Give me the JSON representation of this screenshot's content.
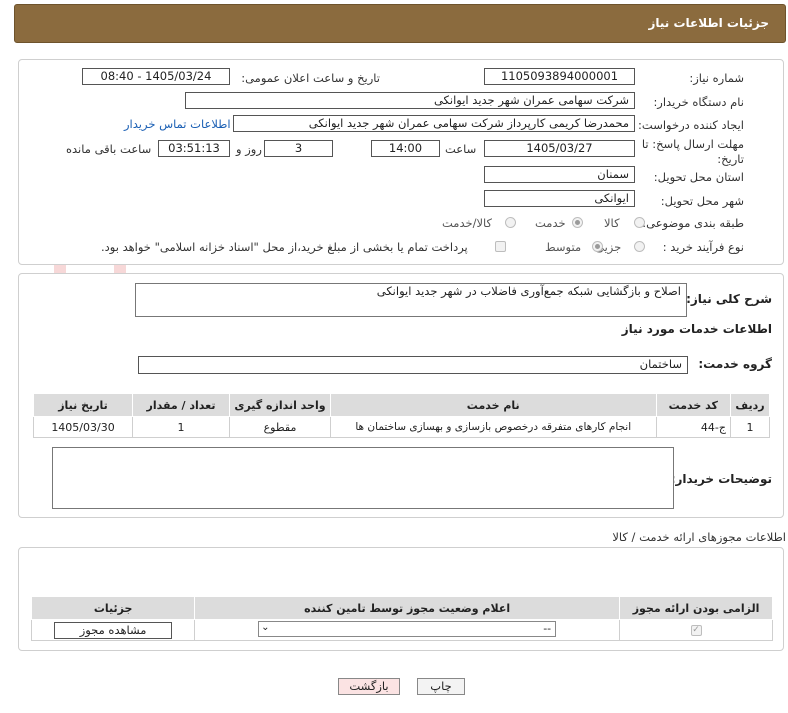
{
  "header": {
    "title": "جزئیات اطلاعات نیاز"
  },
  "form": {
    "need_number_label": "شماره نیاز:",
    "need_number": "1105093894000001",
    "announce_label": "تاریخ و ساعت اعلان عمومی:",
    "announce_value": "1405/03/24 - 08:40",
    "buyer_org_label": "نام دستگاه خریدار:",
    "buyer_org": "شرکت سهامی عمران شهر جدید ایوانکی",
    "creator_label": "ایجاد کننده درخواست:",
    "creator": "محمدرضا کریمی کارپرداز شرکت سهامی عمران شهر جدید ایوانکی",
    "contact_link": "اطلاعات تماس خریدار",
    "deadline_label_1": "مهلت ارسال پاسخ: تا",
    "deadline_label_2": "تاریخ:",
    "deadline_date": "1405/03/27",
    "time_label": "ساعت",
    "deadline_time": "14:00",
    "days_value": "3",
    "days_label": "روز و",
    "remaining_time": "03:51:13",
    "remaining_label": "ساعت باقی مانده",
    "province_label": "استان محل تحویل:",
    "province": "سمنان",
    "city_label": "شهر محل تحویل:",
    "city": "ایوانکی",
    "category_label": "طبقه بندی موضوعی:",
    "category_options": [
      "کالا",
      "خدمت",
      "کالا/خدمت"
    ],
    "category_selected": "خدمت",
    "process_label": "نوع فرآیند خرید :",
    "process_options": [
      "جزیی",
      "متوسط"
    ],
    "process_selected": "متوسط",
    "payment_note": "پرداخت تمام یا بخشی از مبلغ خرید،از محل \"اسناد خزانه اسلامی\" خواهد بود."
  },
  "summary": {
    "label": "شرح کلی نیاز:",
    "value": "اصلاح و بازگشایی شبکه جمع‌آوری فاضلاب در شهر جدید ایوانکی"
  },
  "services": {
    "section_title": "اطلاعات خدمات مورد نیاز",
    "group_label": "گروه خدمت:",
    "group_value": "ساختمان",
    "columns": [
      "ردیف",
      "کد خدمت",
      "نام خدمت",
      "واحد اندازه گیری",
      "تعداد / مقدار",
      "تاریخ نیاز"
    ],
    "rows": [
      [
        "1",
        "ج-44",
        "انجام کارهای متفرقه درخصوص بازسازی و بهسازی ساختمان ها",
        "مقطوع",
        "1",
        "1405/03/30"
      ]
    ],
    "buyer_notes_label": "توضیحات خریدار:"
  },
  "permits": {
    "section_title": "اطلاعات مجوزهای ارائه خدمت / کالا",
    "columns": [
      "الزامی بودن ارائه مجوز",
      "اعلام وضعیت مجوز توسط تامین کننده",
      "جزئیات"
    ],
    "select_value": "--",
    "view_button": "مشاهده مجوز"
  },
  "buttons": {
    "print": "چاپ",
    "back": "بازگشت"
  },
  "watermark": {
    "text": "AriaTender.net"
  },
  "colors": {
    "header_bg": "#8b6b3e",
    "link": "#1a5fb4",
    "back_button_bg": "#fbe3e3"
  }
}
